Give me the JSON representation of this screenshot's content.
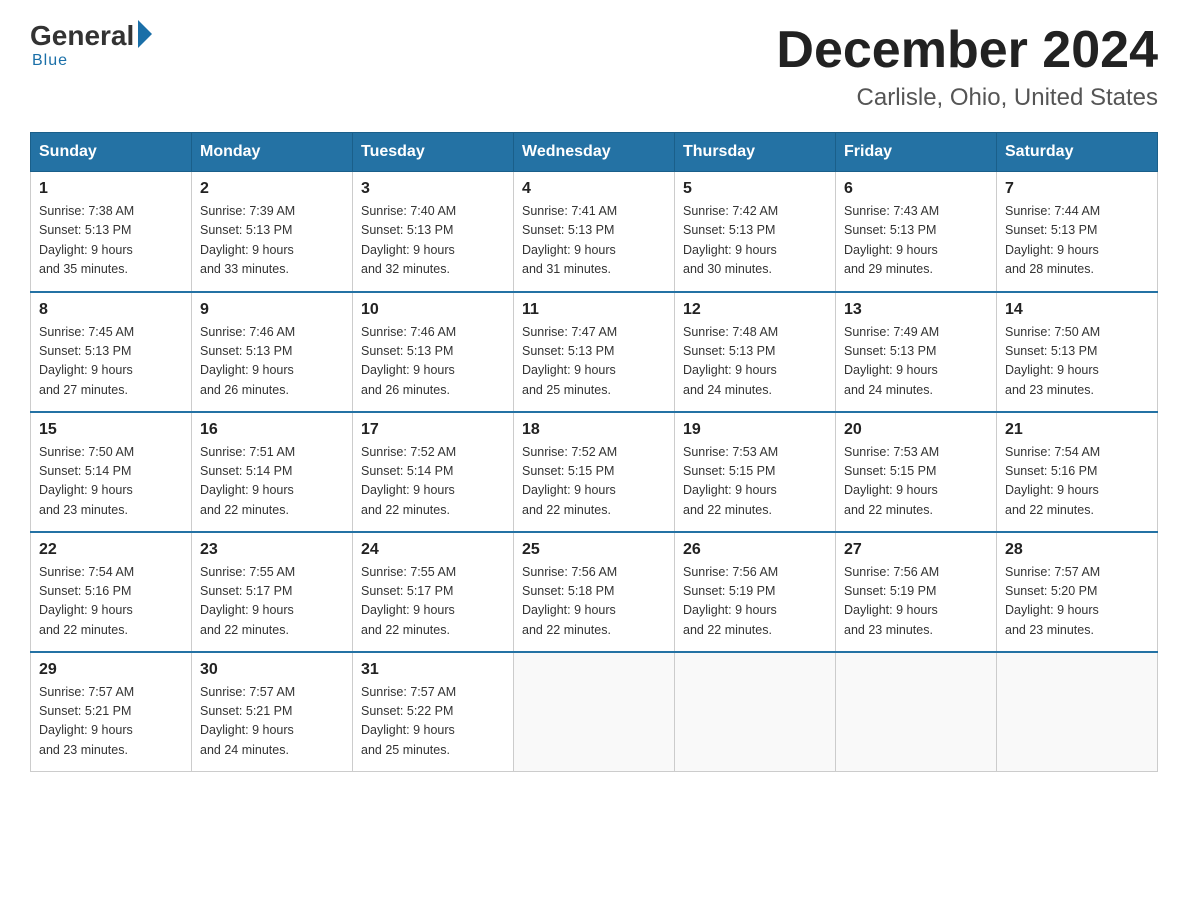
{
  "logo": {
    "general": "General",
    "blue": "Blue",
    "tagline": "Blue"
  },
  "title": {
    "month": "December 2024",
    "location": "Carlisle, Ohio, United States"
  },
  "weekdays": [
    "Sunday",
    "Monday",
    "Tuesday",
    "Wednesday",
    "Thursday",
    "Friday",
    "Saturday"
  ],
  "weeks": [
    [
      {
        "day": "1",
        "sunrise": "7:38 AM",
        "sunset": "5:13 PM",
        "daylight": "9 hours and 35 minutes."
      },
      {
        "day": "2",
        "sunrise": "7:39 AM",
        "sunset": "5:13 PM",
        "daylight": "9 hours and 33 minutes."
      },
      {
        "day": "3",
        "sunrise": "7:40 AM",
        "sunset": "5:13 PM",
        "daylight": "9 hours and 32 minutes."
      },
      {
        "day": "4",
        "sunrise": "7:41 AM",
        "sunset": "5:13 PM",
        "daylight": "9 hours and 31 minutes."
      },
      {
        "day": "5",
        "sunrise": "7:42 AM",
        "sunset": "5:13 PM",
        "daylight": "9 hours and 30 minutes."
      },
      {
        "day": "6",
        "sunrise": "7:43 AM",
        "sunset": "5:13 PM",
        "daylight": "9 hours and 29 minutes."
      },
      {
        "day": "7",
        "sunrise": "7:44 AM",
        "sunset": "5:13 PM",
        "daylight": "9 hours and 28 minutes."
      }
    ],
    [
      {
        "day": "8",
        "sunrise": "7:45 AM",
        "sunset": "5:13 PM",
        "daylight": "9 hours and 27 minutes."
      },
      {
        "day": "9",
        "sunrise": "7:46 AM",
        "sunset": "5:13 PM",
        "daylight": "9 hours and 26 minutes."
      },
      {
        "day": "10",
        "sunrise": "7:46 AM",
        "sunset": "5:13 PM",
        "daylight": "9 hours and 26 minutes."
      },
      {
        "day": "11",
        "sunrise": "7:47 AM",
        "sunset": "5:13 PM",
        "daylight": "9 hours and 25 minutes."
      },
      {
        "day": "12",
        "sunrise": "7:48 AM",
        "sunset": "5:13 PM",
        "daylight": "9 hours and 24 minutes."
      },
      {
        "day": "13",
        "sunrise": "7:49 AM",
        "sunset": "5:13 PM",
        "daylight": "9 hours and 24 minutes."
      },
      {
        "day": "14",
        "sunrise": "7:50 AM",
        "sunset": "5:13 PM",
        "daylight": "9 hours and 23 minutes."
      }
    ],
    [
      {
        "day": "15",
        "sunrise": "7:50 AM",
        "sunset": "5:14 PM",
        "daylight": "9 hours and 23 minutes."
      },
      {
        "day": "16",
        "sunrise": "7:51 AM",
        "sunset": "5:14 PM",
        "daylight": "9 hours and 22 minutes."
      },
      {
        "day": "17",
        "sunrise": "7:52 AM",
        "sunset": "5:14 PM",
        "daylight": "9 hours and 22 minutes."
      },
      {
        "day": "18",
        "sunrise": "7:52 AM",
        "sunset": "5:15 PM",
        "daylight": "9 hours and 22 minutes."
      },
      {
        "day": "19",
        "sunrise": "7:53 AM",
        "sunset": "5:15 PM",
        "daylight": "9 hours and 22 minutes."
      },
      {
        "day": "20",
        "sunrise": "7:53 AM",
        "sunset": "5:15 PM",
        "daylight": "9 hours and 22 minutes."
      },
      {
        "day": "21",
        "sunrise": "7:54 AM",
        "sunset": "5:16 PM",
        "daylight": "9 hours and 22 minutes."
      }
    ],
    [
      {
        "day": "22",
        "sunrise": "7:54 AM",
        "sunset": "5:16 PM",
        "daylight": "9 hours and 22 minutes."
      },
      {
        "day": "23",
        "sunrise": "7:55 AM",
        "sunset": "5:17 PM",
        "daylight": "9 hours and 22 minutes."
      },
      {
        "day": "24",
        "sunrise": "7:55 AM",
        "sunset": "5:17 PM",
        "daylight": "9 hours and 22 minutes."
      },
      {
        "day": "25",
        "sunrise": "7:56 AM",
        "sunset": "5:18 PM",
        "daylight": "9 hours and 22 minutes."
      },
      {
        "day": "26",
        "sunrise": "7:56 AM",
        "sunset": "5:19 PM",
        "daylight": "9 hours and 22 minutes."
      },
      {
        "day": "27",
        "sunrise": "7:56 AM",
        "sunset": "5:19 PM",
        "daylight": "9 hours and 23 minutes."
      },
      {
        "day": "28",
        "sunrise": "7:57 AM",
        "sunset": "5:20 PM",
        "daylight": "9 hours and 23 minutes."
      }
    ],
    [
      {
        "day": "29",
        "sunrise": "7:57 AM",
        "sunset": "5:21 PM",
        "daylight": "9 hours and 23 minutes."
      },
      {
        "day": "30",
        "sunrise": "7:57 AM",
        "sunset": "5:21 PM",
        "daylight": "9 hours and 24 minutes."
      },
      {
        "day": "31",
        "sunrise": "7:57 AM",
        "sunset": "5:22 PM",
        "daylight": "9 hours and 25 minutes."
      },
      null,
      null,
      null,
      null
    ]
  ],
  "labels": {
    "sunrise": "Sunrise:",
    "sunset": "Sunset:",
    "daylight": "Daylight:"
  }
}
